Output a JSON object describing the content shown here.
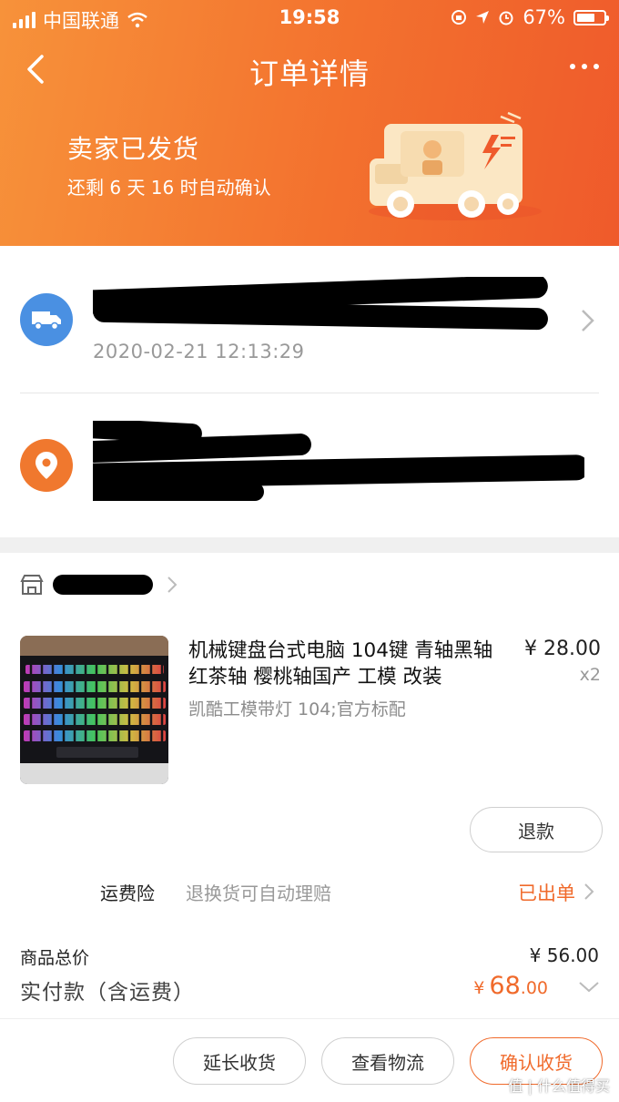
{
  "status_bar": {
    "carrier": "中国联通",
    "time": "19:58",
    "battery": "67%"
  },
  "nav": {
    "title": "订单详情"
  },
  "header": {
    "status": "卖家已发货",
    "countdown": "还剩 6 天 16 时自动确认"
  },
  "logistics": {
    "date": "2020-02-21 12:13:29"
  },
  "product": {
    "title": "机械键盘台式电脑 104键 青轴黑轴红茶轴 樱桃轴国产 工模 改装",
    "spec": "凯酷工模带灯 104;官方标配",
    "price": "¥ 28.00",
    "qty": "x2",
    "refund_label": "退款"
  },
  "insurance": {
    "label": "运费险",
    "desc": "退换货可自动理赔",
    "status": "已出单"
  },
  "totals": {
    "goods_label": "商品总价",
    "goods_value": "¥ 56.00",
    "paid_label": "实付款（含运费）",
    "paid_currency": "¥",
    "paid_int": "68",
    "paid_dec": ".00"
  },
  "actions": {
    "extend": "延长收货",
    "logistics": "查看物流",
    "confirm": "确认收货"
  },
  "watermark": "值 | 什么值得买",
  "colors": {
    "accent": "#f06a2b",
    "logistics_blue": "#4a90e2",
    "header_start": "#f7923a",
    "header_end": "#ef5a2b"
  }
}
